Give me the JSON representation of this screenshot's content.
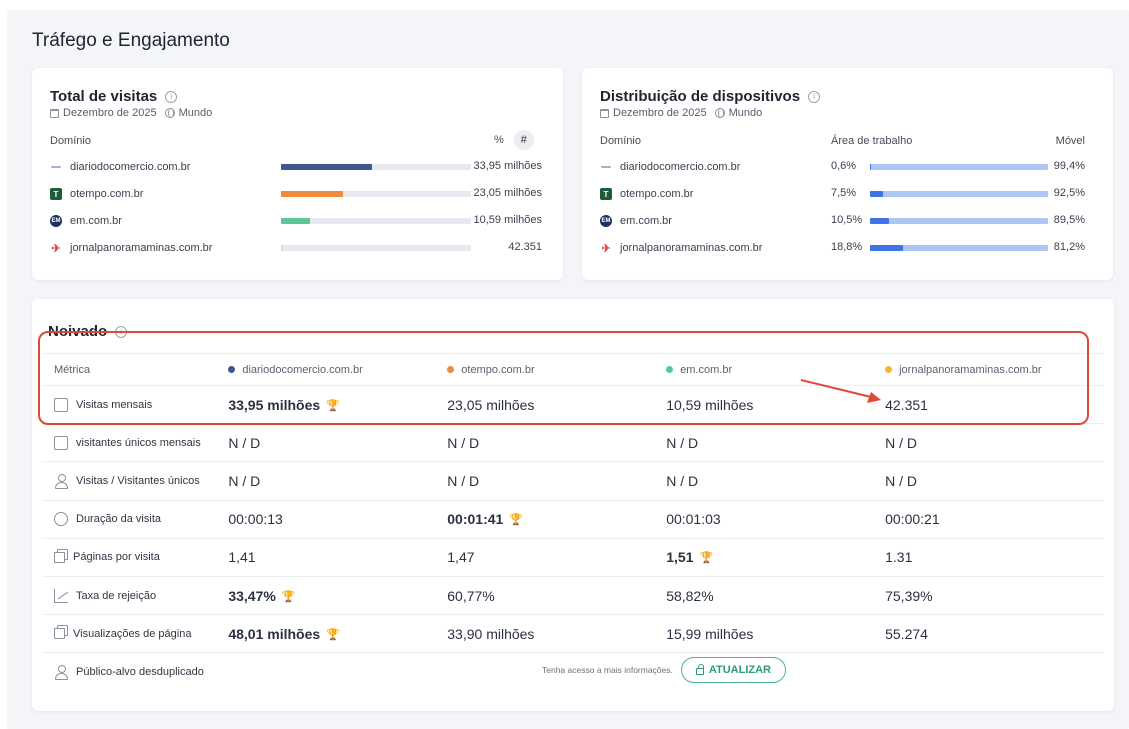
{
  "section": {
    "title": "Tráfego e Engajamento"
  },
  "visits_card": {
    "title": "Total de visitas",
    "period": "Dezembro de 2025",
    "region": "Mundo",
    "domain_header": "Domínio",
    "toggle_percent": "%",
    "toggle_hash": "#",
    "rows": [
      {
        "domain": "diariodocomercio.com.br",
        "value": "33,95 milhões",
        "share": 0.4813,
        "color": "#3f5590"
      },
      {
        "domain": "otempo.com.br",
        "value": "23,05 milhões",
        "share": 0.3268,
        "color": "#ee8a3b"
      },
      {
        "domain": "em.com.br",
        "value": "10,59 milhões",
        "share": 0.1501,
        "color": "#5cc796"
      },
      {
        "domain": "jornalpanoramaminas.com.br",
        "value": "42.351",
        "share": 0.006,
        "color": "#cfd3da"
      }
    ]
  },
  "devices_card": {
    "title": "Distribuição de dispositivos",
    "period": "Dezembro de 2025",
    "region": "Mundo",
    "domain_header": "Domínio",
    "desktop_header": "Área de trabalho",
    "mobile_header": "Móvel",
    "desktop_color": "#3f74e6",
    "mobile_color": "#aec6f3",
    "rows": [
      {
        "domain": "diariodocomercio.com.br",
        "desktop": "0,6%",
        "mobile": "99,4%",
        "desktop_share": 0.006
      },
      {
        "domain": "otempo.com.br",
        "desktop": "7,5%",
        "mobile": "92,5%",
        "desktop_share": 0.075
      },
      {
        "domain": "em.com.br",
        "desktop": "10,5%",
        "mobile": "89,5%",
        "desktop_share": 0.105
      },
      {
        "domain": "jornalpanoramaminas.com.br",
        "desktop": "18,8%",
        "mobile": "81,2%",
        "desktop_share": 0.188
      }
    ]
  },
  "table": {
    "title": "Noivado",
    "metric_header": "Métrica",
    "columns": [
      {
        "label": "diariodocomercio.com.br",
        "dot": "#3f5590"
      },
      {
        "label": "otempo.com.br",
        "dot": "#ee8a3b"
      },
      {
        "label": "em.com.br",
        "dot": "#5cc796"
      },
      {
        "label": "jornalpanoramaminas.com.br",
        "dot": "#f2b630"
      }
    ],
    "rows": [
      {
        "metric": "Visitas mensais",
        "icon": "calendar-icon",
        "values": [
          "33,95 milhões",
          "23,05 milhões",
          "10,59 milhões",
          "42.351"
        ],
        "winner": 0
      },
      {
        "metric": "visitantes únicos mensais",
        "icon": "user-card-icon",
        "values": [
          "N / D",
          "N / D",
          "N / D",
          "N / D"
        ],
        "winner": -1
      },
      {
        "metric": "Visitas / Visitantes únicos",
        "icon": "person-icon",
        "values": [
          "N / D",
          "N / D",
          "N / D",
          "N / D"
        ],
        "winner": -1
      },
      {
        "metric": "Duração da visita",
        "icon": "timer-icon",
        "values": [
          "00:00:13",
          "00:01:41",
          "00:01:03",
          "00:00:21"
        ],
        "winner": 1
      },
      {
        "metric": "Páginas por visita",
        "icon": "pages-icon",
        "values": [
          "1,41",
          "1,47",
          "1,51",
          "1.31"
        ],
        "winner": 2
      },
      {
        "metric": "Taxa de rejeição",
        "icon": "trend-icon",
        "values": [
          "33,47%",
          "60,77%",
          "58,82%",
          "75,39%"
        ],
        "winner": 0
      },
      {
        "metric": "Visualizações de página",
        "icon": "pages-icon",
        "values": [
          "48,01 milhões",
          "33,90 milhões",
          "15,99 milhões",
          "55.274"
        ],
        "winner": 0
      }
    ],
    "audience": {
      "metric": "Público-alvo desduplicado",
      "prompt": "Tenha acesso a mais informações.",
      "button": "ATUALIZAR"
    }
  }
}
